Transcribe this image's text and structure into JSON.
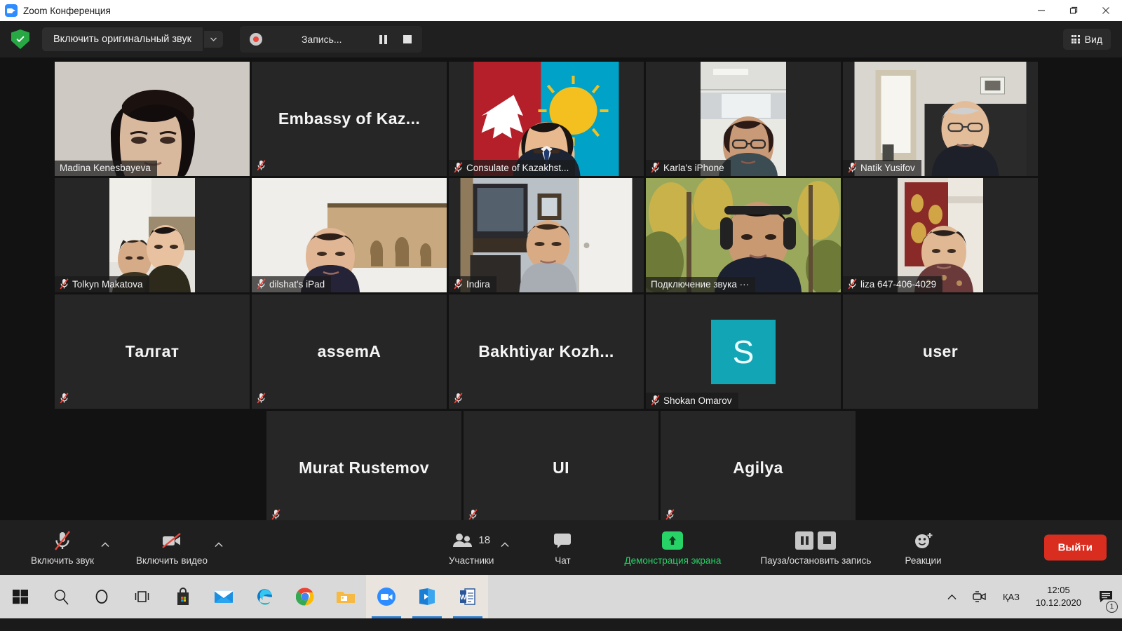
{
  "window": {
    "title": "Zoom Конференция",
    "icon": "zoom-video-icon",
    "minimize": "–",
    "maximize": "❐",
    "close": "✕"
  },
  "toolbar": {
    "shield_icon": "security-shield-icon",
    "original_sound_label": "Включить оригинальный звук",
    "original_sound_caret": "▼",
    "recording_status": "Запись...",
    "recording_dot_icon": "record-dot-icon",
    "pause_icon": "pause-icon",
    "stop_icon": "stop-icon",
    "view_label": "Вид",
    "view_icon": "grid-view-icon"
  },
  "grid": {
    "rows": [
      [
        {
          "name": "Madina Kenesbayeva",
          "kind": "video",
          "muted": false,
          "active_speaker": true,
          "nameplate": true
        },
        {
          "name": "Embassy of Kaz...",
          "kind": "name-only",
          "muted": true,
          "active_speaker": false,
          "nameplate": false
        },
        {
          "name": "Consulate of Kazakhst...",
          "kind": "video",
          "muted": true,
          "active_speaker": false,
          "nameplate": true
        },
        {
          "name": "Karla's iPhone",
          "kind": "video",
          "muted": true,
          "active_speaker": false,
          "nameplate": true
        },
        {
          "name": "Natik Yusifov",
          "kind": "video",
          "muted": true,
          "active_speaker": false,
          "nameplate": true
        }
      ],
      [
        {
          "name": "Tolkyn Makatova",
          "kind": "video",
          "muted": true,
          "active_speaker": false,
          "nameplate": true
        },
        {
          "name": "dilshat's iPad",
          "kind": "video",
          "muted": true,
          "active_speaker": false,
          "nameplate": true
        },
        {
          "name": "Indira",
          "kind": "video",
          "muted": true,
          "active_speaker": false,
          "nameplate": true
        },
        {
          "name": "Подключение звука ···",
          "kind": "video",
          "muted": false,
          "active_speaker": false,
          "nameplate": true
        },
        {
          "name": "liza 647-406-4029",
          "kind": "video",
          "muted": true,
          "active_speaker": false,
          "nameplate": true
        }
      ],
      [
        {
          "name": "Талгат",
          "kind": "name-only",
          "muted": true,
          "active_speaker": false,
          "nameplate": false
        },
        {
          "name": "assemA",
          "kind": "name-only",
          "muted": true,
          "active_speaker": false,
          "nameplate": false
        },
        {
          "name": "Bakhtiyar Kozh...",
          "kind": "name-only",
          "muted": true,
          "active_speaker": false,
          "nameplate": false
        },
        {
          "name": "Shokan Omarov",
          "kind": "avatar",
          "avatar_letter": "S",
          "avatar_color": "#12a5b5",
          "muted": true,
          "active_speaker": false,
          "nameplate": true
        },
        {
          "name": "user",
          "kind": "name-only",
          "muted": false,
          "active_speaker": false,
          "nameplate": false
        }
      ],
      [
        {
          "name": "Murat Rustemov",
          "kind": "name-only",
          "muted": true,
          "active_speaker": false,
          "nameplate": false
        },
        {
          "name": "UI",
          "kind": "name-only",
          "muted": true,
          "active_speaker": false,
          "nameplate": false
        },
        {
          "name": "Agilya",
          "kind": "name-only",
          "muted": true,
          "active_speaker": false,
          "nameplate": false
        }
      ]
    ]
  },
  "controls": {
    "audio": {
      "label": "Включить звук",
      "icon": "mic-muted-icon",
      "caret": "⌃"
    },
    "video": {
      "label": "Включить видео",
      "icon": "camera-off-icon",
      "caret": "⌃"
    },
    "participants": {
      "label": "Участники",
      "icon": "participants-icon",
      "count": "18",
      "caret": "⌃"
    },
    "chat": {
      "label": "Чат",
      "icon": "chat-bubble-icon"
    },
    "share": {
      "label": "Демонстрация экрана",
      "icon": "share-screen-icon",
      "color": "#27d367"
    },
    "record": {
      "label": "Пауза/остановить запись",
      "pause_icon": "pause-icon",
      "stop_icon": "stop-icon"
    },
    "reactions": {
      "label": "Реакции",
      "icon": "smiley-plus-icon"
    },
    "leave": {
      "label": "Выйти",
      "color": "#d92d20"
    }
  },
  "taskbar": {
    "items": [
      {
        "name": "start-button",
        "icon": "windows-logo-icon"
      },
      {
        "name": "search-button",
        "icon": "search-icon"
      },
      {
        "name": "cortana-button",
        "icon": "cortana-circle-icon"
      },
      {
        "name": "task-view-button",
        "icon": "task-view-icon"
      },
      {
        "name": "microsoft-store",
        "icon": "store-bag-icon"
      },
      {
        "name": "mail-app",
        "icon": "mail-envelope-icon"
      },
      {
        "name": "microsoft-edge",
        "icon": "edge-icon"
      },
      {
        "name": "google-chrome",
        "icon": "chrome-icon"
      },
      {
        "name": "file-explorer",
        "icon": "folder-icon"
      },
      {
        "name": "zoom-app",
        "icon": "zoom-video-icon"
      },
      {
        "name": "movies-tv-app",
        "icon": "movies-tv-icon"
      },
      {
        "name": "microsoft-word",
        "icon": "word-icon"
      }
    ],
    "tray": {
      "show_hidden_icons": "⌃",
      "camera_icon": "camera-tray-icon",
      "language": "ҚАЗ",
      "time": "12:05",
      "date": "10.12.2020",
      "notification_icon": "notification-icon",
      "notification_count": "1"
    }
  }
}
